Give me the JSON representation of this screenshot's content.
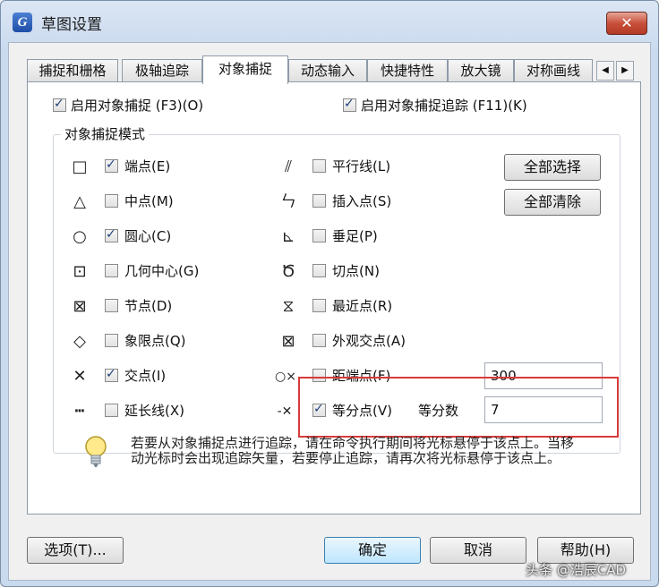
{
  "window": {
    "title": "草图设置",
    "icon_letter": "G",
    "close_label": "✕"
  },
  "tabs": [
    {
      "label": "捕捉和栅格",
      "active": false
    },
    {
      "label": "极轴追踪",
      "active": false
    },
    {
      "label": "对象捕捉",
      "active": true
    },
    {
      "label": "动态输入",
      "active": false
    },
    {
      "label": "快捷特性",
      "active": false
    },
    {
      "label": "放大镜",
      "active": false
    },
    {
      "label": "对称画线",
      "active": false
    }
  ],
  "tab_scroll": {
    "left": "◀",
    "right": "▶"
  },
  "top_options": {
    "enable_snap": {
      "label": "启用对象捕捉 (F3)(O)",
      "checked": true
    },
    "enable_tracking": {
      "label": "启用对象捕捉追踪 (F11)(K)",
      "checked": true
    }
  },
  "group": {
    "title": "对象捕捉模式"
  },
  "modes_left": [
    {
      "label": "端点(E)",
      "checked": true,
      "icon": "□"
    },
    {
      "label": "中点(M)",
      "checked": false,
      "icon": "△"
    },
    {
      "label": "圆心(C)",
      "checked": true,
      "icon": "○"
    },
    {
      "label": "几何中心(G)",
      "checked": false,
      "icon": "⊡"
    },
    {
      "label": "节点(D)",
      "checked": false,
      "icon": "⊠"
    },
    {
      "label": "象限点(Q)",
      "checked": false,
      "icon": "◇"
    },
    {
      "label": "交点(I)",
      "checked": true,
      "icon": "✕"
    },
    {
      "label": "延长线(X)",
      "checked": false,
      "icon": "┅"
    }
  ],
  "modes_right": [
    {
      "label": "平行线(L)",
      "checked": false,
      "icon": "⫽"
    },
    {
      "label": "插入点(S)",
      "checked": false,
      "icon": "ㄣ"
    },
    {
      "label": "垂足(P)",
      "checked": false,
      "icon": "⊾"
    },
    {
      "label": "切点(N)",
      "checked": false,
      "icon": "Ծ"
    },
    {
      "label": "最近点(R)",
      "checked": false,
      "icon": "⧖"
    },
    {
      "label": "外观交点(A)",
      "checked": false,
      "icon": "⊠"
    },
    {
      "label": "距端点(F)",
      "checked": false,
      "icon": "○×"
    },
    {
      "label": "等分点(V)",
      "checked": true,
      "icon": "-✕"
    }
  ],
  "side_buttons": {
    "select_all": "全部选择",
    "clear_all": "全部清除"
  },
  "distance_value": "300",
  "divide_label": "等分数",
  "divide_value": "7",
  "info": "若要从对象捕捉点进行追踪，请在命令执行期间将光标悬停于该点上。当移动光标时会出现追踪矢量，若要停止追踪，请再次将光标悬停于该点上。",
  "footer": {
    "options": "选项(T)...",
    "ok": "确定",
    "cancel": "取消",
    "help": "帮助(H)"
  },
  "watermark": "头条 @浩辰CAD"
}
